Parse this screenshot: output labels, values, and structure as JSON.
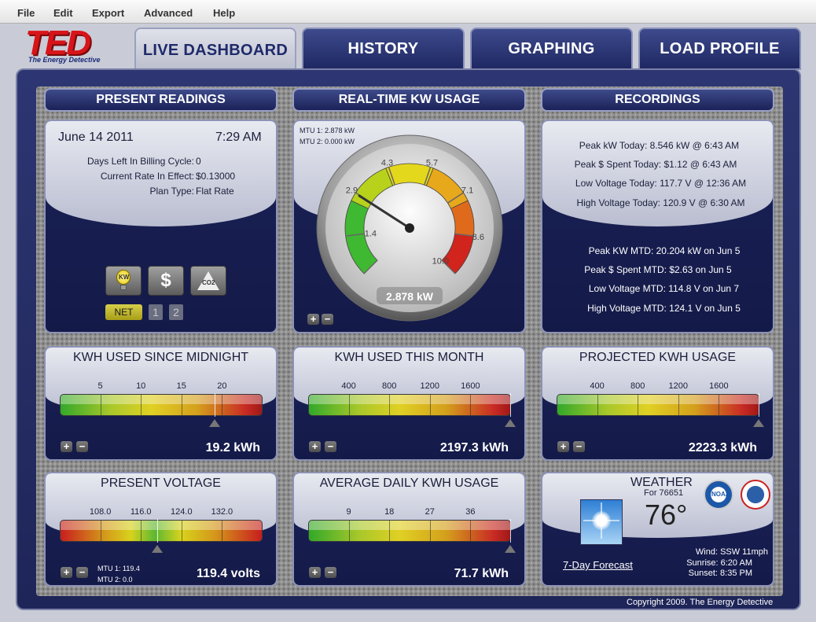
{
  "menu": [
    "File",
    "Edit",
    "Export",
    "Advanced",
    "Help"
  ],
  "logo": {
    "text": "TED",
    "subtitle": "The Energy Detective"
  },
  "tabs": [
    "LIVE DASHBOARD",
    "HISTORY",
    "GRAPHING",
    "LOAD PROFILE"
  ],
  "headers": {
    "present": "PRESENT READINGS",
    "realtime": "REAL-TIME KW USAGE",
    "recordings": "RECORDINGS"
  },
  "present": {
    "date": "June 14 2011",
    "time": "7:29 AM",
    "rows": [
      {
        "label": "Days Left In Billing Cycle:",
        "value": "0"
      },
      {
        "label": "Current Rate In Effect:",
        "value": "$0.13000"
      },
      {
        "label": "Plan Type:",
        "value": "Flat Rate"
      }
    ],
    "net": "NET",
    "mtu1": "1",
    "mtu2": "2",
    "buttons": [
      "KW",
      "$",
      "CO2"
    ]
  },
  "gauge": {
    "mtu1": "MTU 1: 2.878 kW",
    "mtu2": "MTU 2: 0.000 kW",
    "ticks": [
      "1.4",
      "2.9",
      "4.3",
      "5.7",
      "7.1",
      "8.6",
      "10.0"
    ],
    "value": 2.878,
    "display": "2.878 kW"
  },
  "recordings": {
    "today": [
      "Peak kW Today: 8.546 kW @ 6:43 AM",
      "Peak $ Spent Today: $1.12 @ 6:43 AM",
      "Low Voltage Today: 117.7 V @ 12:36 AM",
      "High Voltage Today: 120.9 V @ 6:30 AM"
    ],
    "mtd": [
      "Peak KW MTD: 20.204 kW on Jun 5",
      "Peak $ Spent MTD: $2.63 on Jun 5",
      "Low Voltage MTD: 114.8 V on Jun 7",
      "High Voltage MTD: 124.1 V on Jun 5"
    ]
  },
  "meters": [
    {
      "title": "KWH USED SINCE MIDNIGHT",
      "ticks": [
        "5",
        "10",
        "15",
        "20"
      ],
      "value": "19.2 kWh",
      "fraction": 0.765,
      "type": "green"
    },
    {
      "title": "KWH USED THIS MONTH",
      "ticks": [
        "400",
        "800",
        "1200",
        "1600"
      ],
      "value": "2197.3 kWh",
      "fraction": 0.995,
      "type": "green"
    },
    {
      "title": "PROJECTED KWH USAGE",
      "ticks": [
        "400",
        "800",
        "1200",
        "1600"
      ],
      "value": "2223.3 kWh",
      "fraction": 0.995,
      "type": "green"
    },
    {
      "title": "PRESENT VOLTAGE",
      "ticks": [
        "108.0",
        "116.0",
        "124.0",
        "132.0"
      ],
      "value": "119.4 volts",
      "fraction": 0.48,
      "type": "voltage",
      "mtu1": "MTU 1: 119.4",
      "mtu2": "MTU 2: 0.0"
    },
    {
      "title": "AVERAGE DAILY KWH USAGE",
      "ticks": [
        "9",
        "18",
        "27",
        "36"
      ],
      "value": "71.7 kWh",
      "fraction": 0.995,
      "type": "green"
    }
  ],
  "weather": {
    "title": "WEATHER",
    "zip": "For 76651",
    "temp": "76°",
    "forecast": "7-Day Forecast",
    "wind": "Wind: SSW 11mph",
    "sunrise": "Sunrise: 6:20 AM",
    "sunset": "Sunset: 8:35 PM",
    "noaa": "NOAA"
  },
  "copyright": "Copyright 2009. The Energy Detective"
}
